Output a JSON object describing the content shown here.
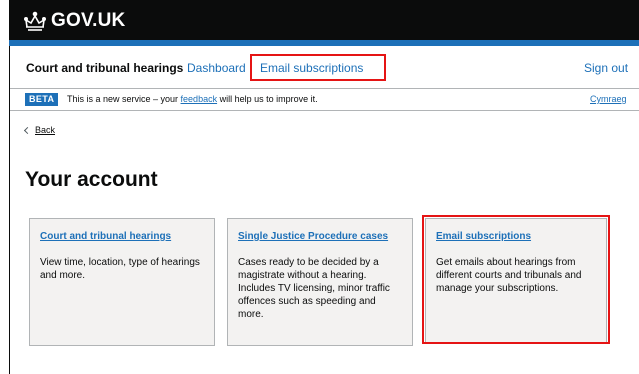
{
  "header": {
    "logo_text": "GOV.UK"
  },
  "service_nav": {
    "service_name": "Court and tribunal hearings",
    "dashboard": "Dashboard",
    "email_subscriptions": "Email subscriptions",
    "sign_out": "Sign out"
  },
  "beta_banner": {
    "tag": "BETA",
    "text_before": "This is a new service – your ",
    "feedback_link": "feedback",
    "text_after": " will help us to improve it.",
    "language_link": "Cymraeg"
  },
  "back_link": "Back",
  "page_title": "Your account",
  "cards": [
    {
      "title": "Court and tribunal hearings",
      "description": "View time, location, type of hearings and more."
    },
    {
      "title": "Single Justice Procedure cases",
      "description": "Cases ready to be decided by a magistrate without a hearing. Includes TV licensing, minor traffic offences such as speeding and more."
    },
    {
      "title": "Email subscriptions",
      "description": "Get emails about hearings from different courts and tribunals and manage your subscriptions."
    }
  ],
  "colors": {
    "header_bg": "#0b0c0c",
    "brand_blue": "#1d70b8",
    "highlight_red": "#e51414",
    "card_bg": "#f3f2f1"
  }
}
